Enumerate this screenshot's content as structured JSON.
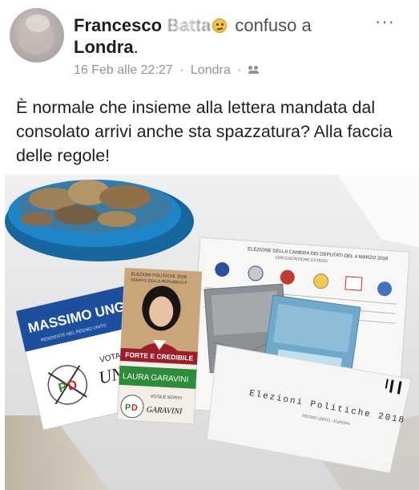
{
  "post": {
    "author_first": "Francesco",
    "author_last": "Batta",
    "feeling_text": "confuso a",
    "location_line": "Londra",
    "location_end": ".",
    "timestamp": "16 Feb alle 22:27",
    "meta_location": "Londra",
    "separator": "·",
    "audience_icon": "friends-icon",
    "more_label": "···",
    "body_text": "È normale che insieme alla lettera mandata dal consolato arrivi anche sta spazzatura? Alla faccia delle regole!"
  },
  "photo": {
    "flyer_left": {
      "name": "MASSIMO UNGA",
      "sub": "RESIDENTE NEL REGNO UNITO",
      "vote": "VOTA E",
      "hand": "UNG"
    },
    "flyer_center": {
      "top1": "ELEZIONI POLITICHE 2018",
      "top2": "SENATO DELLA REPUBBLICA",
      "slogan": "FORTE E CREDIBILE",
      "name": "LAURA GARAVINI",
      "vote": "VOTA E SCRIVI",
      "hand": "GARAVINI"
    },
    "ballot_sheet": {
      "title": "ELEZIONE DELLA CAMERA DEI DEPUTATI DEL 4 MARZO 2018",
      "sub": "CIRCOSCRIZIONE ESTERO"
    },
    "envelope": {
      "lines": "Elezioni Politiche 2018",
      "sub": "REGNO UNITO - EUROPA"
    }
  },
  "colors": {
    "meta_gray": "#90949c",
    "text": "#1c1e21",
    "bowl_blue": "#1f85c9",
    "flyer_blue": "#1d4f9e",
    "pd_green": "#2e8b3a",
    "pd_red": "#d7261e",
    "ballot_gray": "#8c9094",
    "ballot_blue": "#6fa8c9"
  }
}
